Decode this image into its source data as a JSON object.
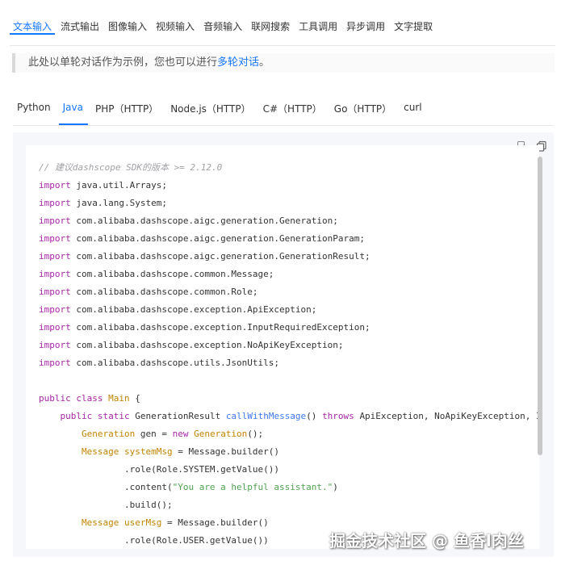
{
  "colors": {
    "accent": "#1677ff"
  },
  "top_tabs": [
    "文本输入",
    "流式输出",
    "图像输入",
    "视频输入",
    "音频输入",
    "联网搜索",
    "工具调用",
    "异步调用",
    "文字提取"
  ],
  "note": {
    "prefix": "此处以单轮对话作为示例，您也可以进行",
    "link": "多轮对话",
    "suffix": "。"
  },
  "lang_tabs": [
    "Python",
    "Java",
    "PHP（HTTP）",
    "Node.js（HTTP）",
    "C#（HTTP）",
    "Go（HTTP）",
    "curl"
  ],
  "toolbar": {
    "icons": [
      "copy-icon",
      "duplicate-icon"
    ]
  },
  "code": {
    "comment": "// 建议dashscope SDK的版本 >= 2.12.0",
    "imports": [
      "java.util.Arrays;",
      "java.lang.System;",
      "com.alibaba.dashscope.aigc.generation.Generation;",
      "com.alibaba.dashscope.aigc.generation.GenerationParam;",
      "com.alibaba.dashscope.aigc.generation.GenerationResult;",
      "com.alibaba.dashscope.common.Message;",
      "com.alibaba.dashscope.common.Role;",
      "com.alibaba.dashscope.exception.ApiException;",
      "com.alibaba.dashscope.exception.InputRequiredException;",
      "com.alibaba.dashscope.exception.NoApiKeyException;",
      "com.alibaba.dashscope.utils.JsonUtils;"
    ],
    "kw_import": "import",
    "kw_public": "public",
    "kw_class": "class",
    "kw_static": "static",
    "kw_throws": "throws",
    "kw_new": "new",
    "class_name": "Main",
    "brace_open": " {",
    "ret_type": "GenerationResult",
    "method_name": "callWithMessage",
    "method_tail": "() ",
    "exceptions": "ApiException, NoApiKeyException, I",
    "gen_type": "Generation",
    "gen_var": " gen = ",
    "gen_ctor": "Generation",
    "gen_tail": "();",
    "msg_type": "Message",
    "sys_var": " systemMsg",
    "builder": " = Message.builder()",
    "role_sys": ".role(Role.SYSTEM.getValue())",
    "content_pre": ".content(",
    "content_str": "\"You are a helpful assistant.\"",
    "content_post": ")",
    "build": ".build();",
    "user_var": " userMsg",
    "last_partial": ".role(Role.USER.getValue())"
  },
  "watermark": "掘金技术社区 @ 鱼香l肉丝"
}
